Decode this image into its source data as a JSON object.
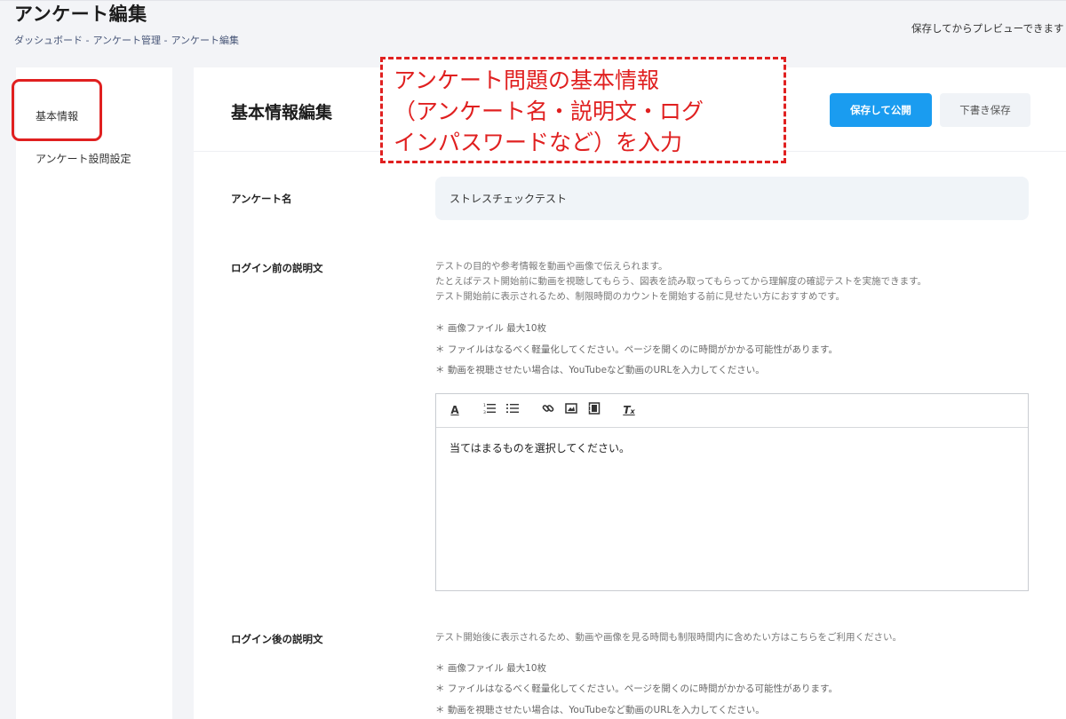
{
  "page": {
    "title": "アンケート編集",
    "breadcrumb": [
      "ダッシュボード -",
      "アンケート管理 -",
      "アンケート編集"
    ],
    "preview_note": "保存してからプレビューできます"
  },
  "sidebar": {
    "items": [
      {
        "label": "基本情報"
      },
      {
        "label": "アンケート設問設定"
      }
    ]
  },
  "header": {
    "section_title": "基本情報編集",
    "publish_label": "保存して公開",
    "draft_label": "下書き保存"
  },
  "fields": {
    "name": {
      "label": "アンケート名",
      "value": "ストレスチェックテスト"
    },
    "before_login": {
      "label": "ログイン前の説明文",
      "description": [
        "テストの目的や参考情報を動画や画像で伝えられます。",
        "たとえばテスト開始前に動画を視聴してもらう、図表を読み取ってもらってから理解度の確認テストを実施できます。",
        "テスト開始前に表示されるため、制限時間のカウントを開始する前に見せたい方におすすめです。"
      ],
      "notes": [
        "＊ 画像ファイル 最大10枚",
        "＊ ファイルはなるべく軽量化してください。ページを開くのに時間がかかる可能性があります。",
        "＊ 動画を視聴させたい場合は、YouTubeなど動画のURLを入力してください。"
      ],
      "editor_content": "当てはまるものを選択してください。",
      "toolbar_icons": [
        "font-color-icon",
        "ordered-list-icon",
        "bullet-list-icon",
        "link-icon",
        "image-icon",
        "video-icon",
        "clear-format-icon"
      ]
    },
    "after_login": {
      "label": "ログイン後の説明文",
      "description": [
        "テスト開始後に表示されるため、動画や画像を見る時間も制限時間内に含めたい方はこちらをご利用ください。"
      ],
      "notes": [
        "＊ 画像ファイル 最大10枚",
        "＊ ファイルはなるべく軽量化してください。ページを開くのに時間がかかる可能性があります。",
        "＊ 動画を視聴させたい場合は、YouTubeなど動画のURLを入力してください。"
      ]
    }
  },
  "callout": {
    "lines": [
      "アンケート問題の基本情報",
      "（アンケート名・説明文・ログ",
      "インパスワードなど）を入力"
    ],
    "color": "#e02020"
  },
  "colors": {
    "accent": "#1a9cf0",
    "annotation": "#e02020"
  }
}
